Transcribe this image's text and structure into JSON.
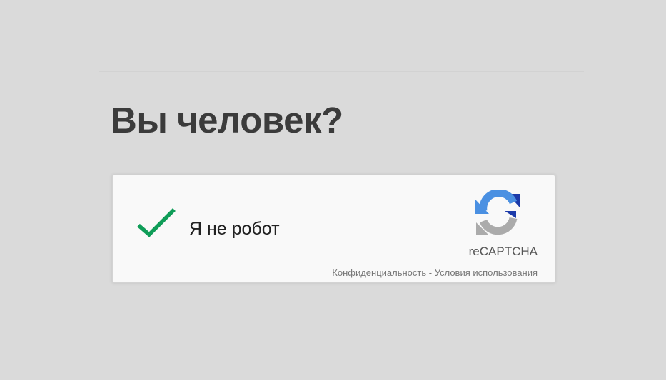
{
  "page": {
    "title": "Вы человек?"
  },
  "captcha": {
    "checkbox_label": "Я не робот",
    "checked": true,
    "brand": "reCAPTCHA",
    "privacy_link": "Конфиденциальность",
    "separator": " - ",
    "terms_link": "Условия использования",
    "check_color": "#0f9d58",
    "logo_blue": "#4a90e2",
    "logo_dark_blue": "#1c3aa9",
    "logo_gray": "#ababab"
  },
  "icons": {
    "check": "checkmark-icon",
    "logo": "recaptcha-logo-icon"
  }
}
